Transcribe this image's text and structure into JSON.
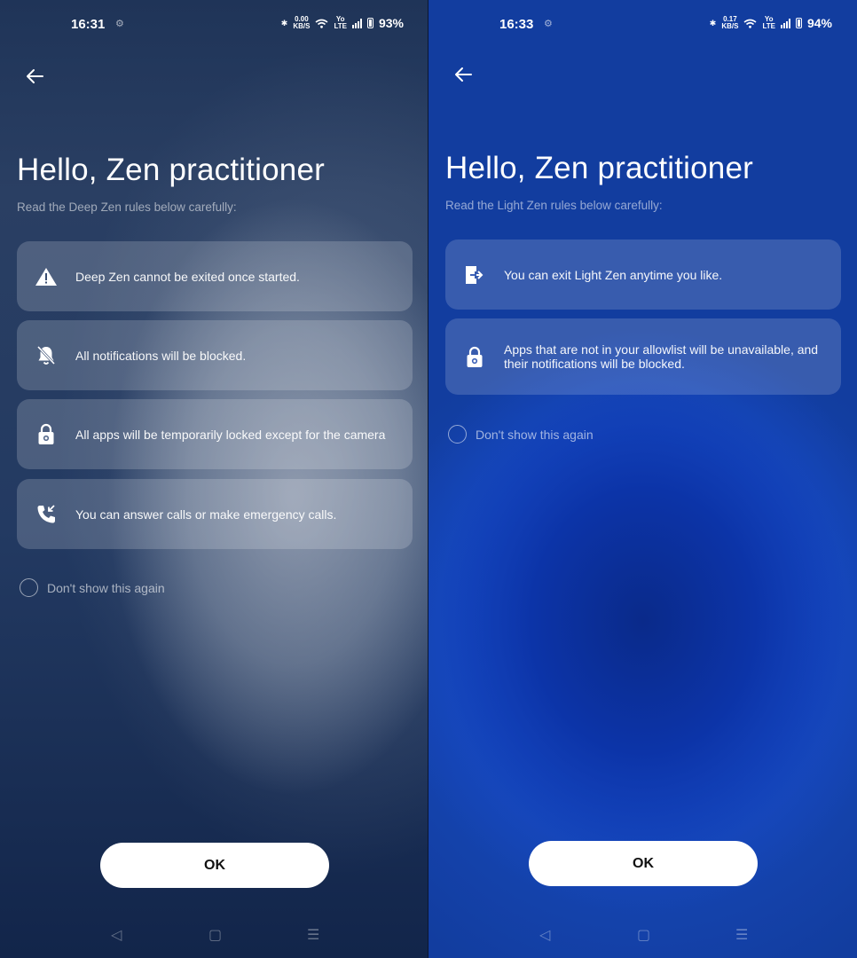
{
  "deep": {
    "status": {
      "time": "16:31",
      "speed_value": "0.00",
      "speed_unit": "KB/S",
      "net_top": "Yo",
      "net_bottom": "LTE",
      "battery": "93%"
    },
    "title": "Hello, Zen practitioner",
    "subtitle": "Read the Deep Zen rules below carefully:",
    "rules": [
      {
        "icon": "warning-icon",
        "text": "Deep Zen cannot be exited once started."
      },
      {
        "icon": "notifications-off-icon",
        "text": "All notifications will be blocked."
      },
      {
        "icon": "lock-icon",
        "text": "All apps will be temporarily locked except for the camera"
      },
      {
        "icon": "phone-call-icon",
        "text": "You can answer calls or make emergency calls."
      }
    ],
    "checkbox_label": "Don't show this again",
    "ok_label": "OK"
  },
  "light": {
    "status": {
      "time": "16:33",
      "speed_value": "0.17",
      "speed_unit": "KB/S",
      "net_top": "Yo",
      "net_bottom": "LTE",
      "battery": "94%"
    },
    "title": "Hello, Zen practitioner",
    "subtitle": "Read the Light Zen rules below carefully:",
    "rules": [
      {
        "icon": "exit-icon",
        "text": "You can exit Light Zen anytime you like."
      },
      {
        "icon": "lock-icon",
        "text": "Apps that are not in your allowlist will be unavailable, and their notifications will be blocked."
      }
    ],
    "checkbox_label": "Don't show this again",
    "ok_label": "OK"
  }
}
